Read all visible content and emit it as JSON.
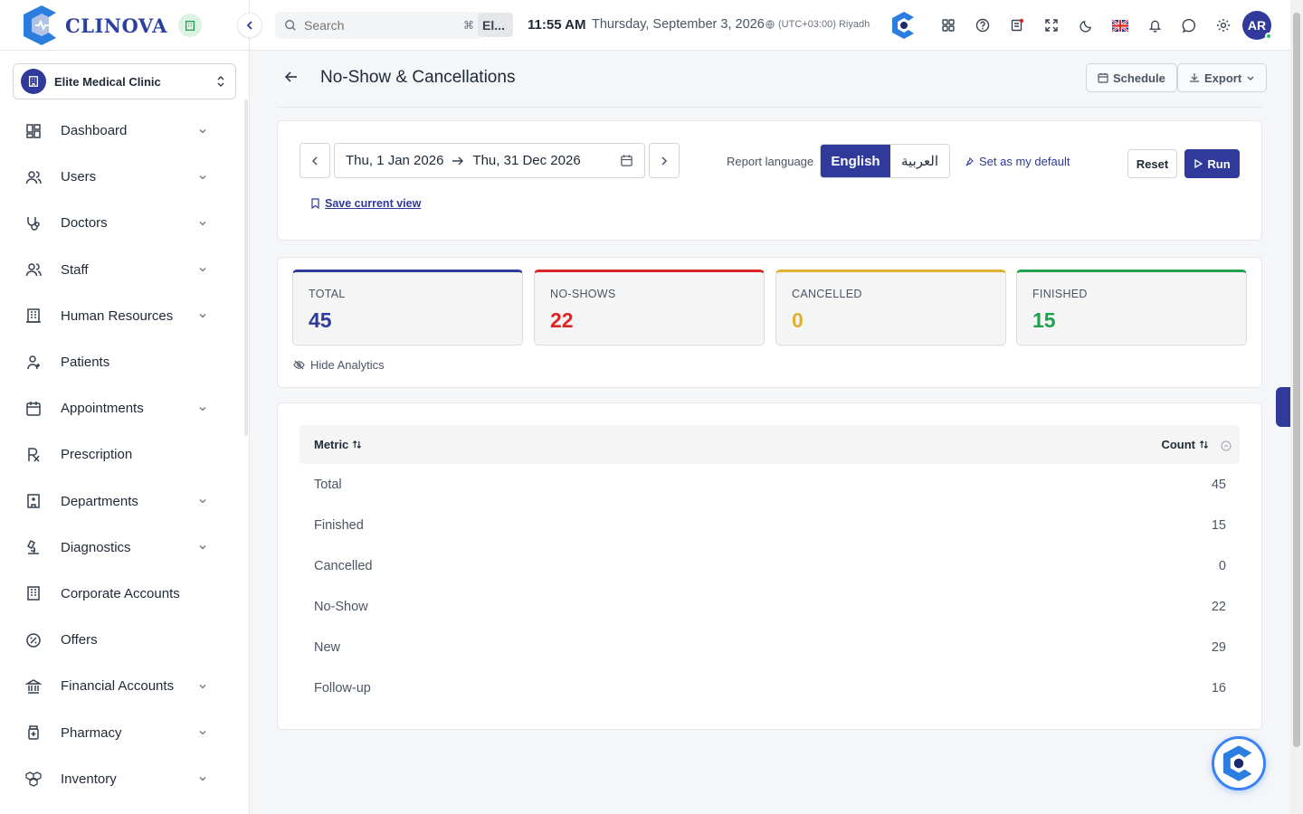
{
  "brand": {
    "name": "CLINOVA"
  },
  "clinic_selector": {
    "value": "Elite Medical Clinic"
  },
  "sidebar": {
    "items": [
      {
        "label": "Dashboard",
        "icon": "dashboard-icon",
        "has_submenu": true
      },
      {
        "label": "Users",
        "icon": "users-icon",
        "has_submenu": true
      },
      {
        "label": "Doctors",
        "icon": "stethoscope-icon",
        "has_submenu": true
      },
      {
        "label": "Staff",
        "icon": "staff-icon",
        "has_submenu": true
      },
      {
        "label": "Human Resources",
        "icon": "building-icon",
        "has_submenu": true
      },
      {
        "label": "Patients",
        "icon": "patient-icon",
        "has_submenu": false
      },
      {
        "label": "Appointments",
        "icon": "calendar-icon",
        "has_submenu": true
      },
      {
        "label": "Prescription",
        "icon": "rx-icon",
        "has_submenu": false
      },
      {
        "label": "Departments",
        "icon": "hospital-icon",
        "has_submenu": true
      },
      {
        "label": "Diagnostics",
        "icon": "microscope-icon",
        "has_submenu": true
      },
      {
        "label": "Corporate Accounts",
        "icon": "office-icon",
        "has_submenu": false
      },
      {
        "label": "Offers",
        "icon": "percent-icon",
        "has_submenu": false
      },
      {
        "label": "Financial Accounts",
        "icon": "bank-icon",
        "has_submenu": true
      },
      {
        "label": "Pharmacy",
        "icon": "pill-bottle-icon",
        "has_submenu": true
      },
      {
        "label": "Inventory",
        "icon": "boxes-icon",
        "has_submenu": true
      }
    ]
  },
  "topbar": {
    "search_placeholder": "Search",
    "search_shortcut": "⌘",
    "crumb_chip": "El...",
    "time": "11:55 AM",
    "date": "Thursday, September 3, 2026",
    "timezone": "(UTC+03:00) Riyadh",
    "avatar_initials": "AR"
  },
  "page": {
    "title": "No-Show & Cancellations",
    "schedule_label": "Schedule",
    "export_label": "Export"
  },
  "filters": {
    "date_from": "Thu, 1 Jan 2026",
    "date_to": "Thu, 31 Dec 2026",
    "report_language_label": "Report language",
    "language_options": [
      "English",
      "العربية"
    ],
    "selected_language": "English",
    "set_default_label": "Set as my default",
    "reset_label": "Reset",
    "run_label": "Run",
    "save_view_label": "Save current view"
  },
  "stats": [
    {
      "label": "TOTAL",
      "value": "45",
      "color": "#2f3a9b"
    },
    {
      "label": "NO-SHOWS",
      "value": "22",
      "color": "#dc2626"
    },
    {
      "label": "CANCELLED",
      "value": "0",
      "color": "#e0b030"
    },
    {
      "label": "FINISHED",
      "value": "15",
      "color": "#22a050"
    }
  ],
  "hide_analytics_label": "Hide Analytics",
  "table": {
    "columns": [
      "Metric",
      "Count"
    ],
    "rows": [
      {
        "metric": "Total",
        "count": "45"
      },
      {
        "metric": "Finished",
        "count": "15"
      },
      {
        "metric": "Cancelled",
        "count": "0"
      },
      {
        "metric": "No-Show",
        "count": "22"
      },
      {
        "metric": "New",
        "count": "29"
      },
      {
        "metric": "Follow-up",
        "count": "16"
      }
    ]
  },
  "colors": {
    "primary": "#2f3a9b",
    "accent_blue": "#3b82f6"
  }
}
